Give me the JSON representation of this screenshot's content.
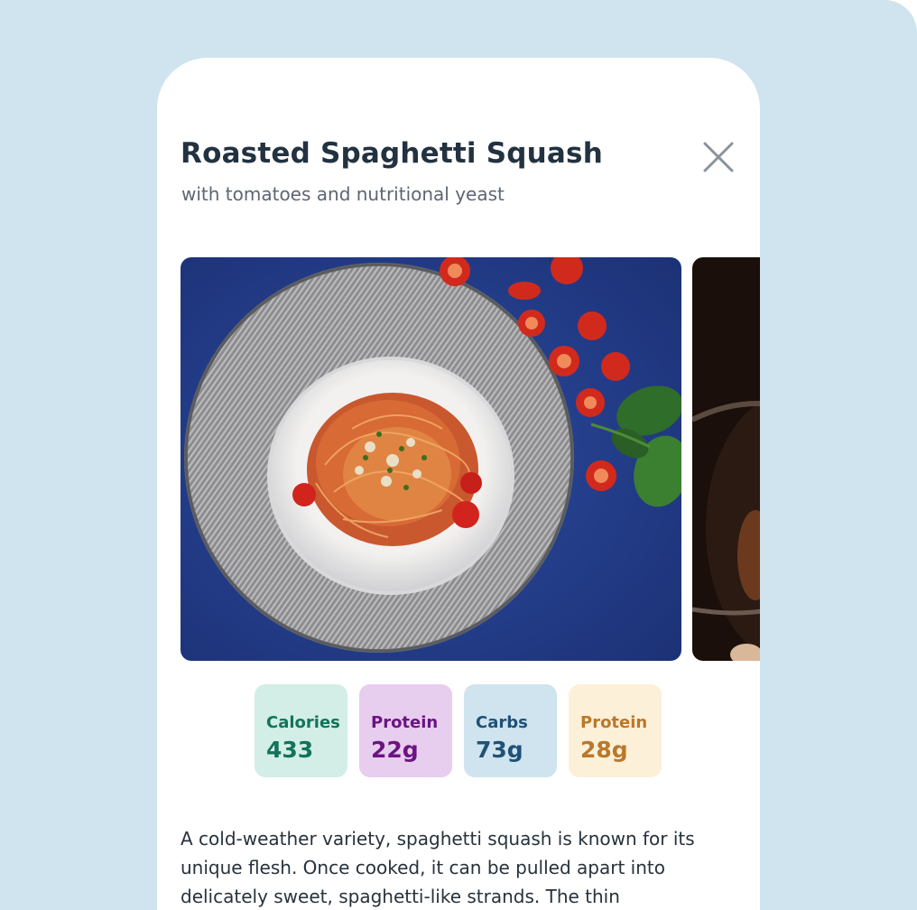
{
  "recipe": {
    "title": "Roasted Spaghetti Squash",
    "subtitle": "with tomatoes and nutritional yeast",
    "description": "A cold-weather variety, spaghetti squash is known for its unique flesh. Once cooked, it can be pulled apart into delicately sweet, spaghetti-like strands. The thin"
  },
  "icons": {
    "close": "close-icon"
  },
  "nutrition": [
    {
      "label": "Calories",
      "value": "433"
    },
    {
      "label": "Protein",
      "value": "22g"
    },
    {
      "label": "Carbs",
      "value": "73g"
    },
    {
      "label": "Protein",
      "value": "28g"
    }
  ],
  "colors": {
    "background": "#cfe4ee",
    "card": "#ffffff",
    "title": "#233240",
    "calories": "#13735a",
    "protein": "#6c1482",
    "carbs": "#1f5278",
    "protein_alt": "#b8782c"
  }
}
